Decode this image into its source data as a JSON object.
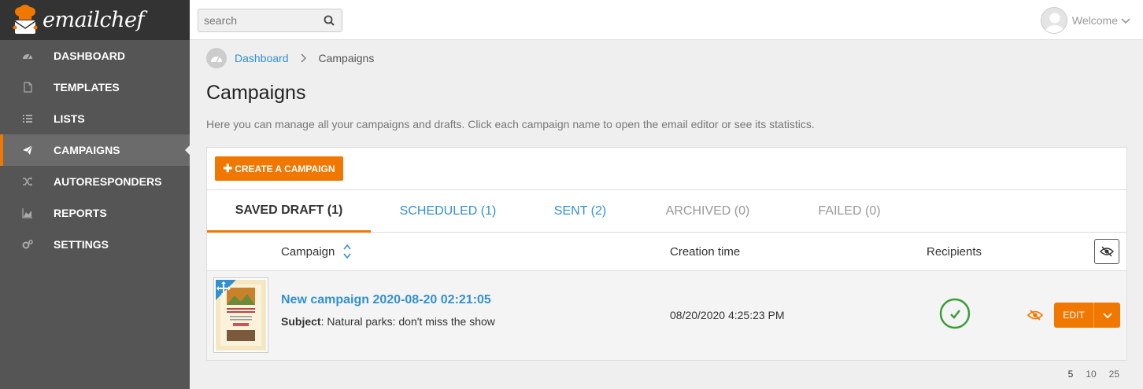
{
  "app": {
    "name": "emailchef"
  },
  "sidebar": {
    "items": [
      {
        "label": "DASHBOARD",
        "icon": "dashboard-icon"
      },
      {
        "label": "TEMPLATES",
        "icon": "file-icon"
      },
      {
        "label": "LISTS",
        "icon": "list-icon"
      },
      {
        "label": "CAMPAIGNS",
        "icon": "paper-plane-icon",
        "active": true
      },
      {
        "label": "AUTORESPONDERS",
        "icon": "shuffle-icon"
      },
      {
        "label": "REPORTS",
        "icon": "area-chart-icon"
      },
      {
        "label": "SETTINGS",
        "icon": "gears-icon"
      }
    ]
  },
  "header": {
    "search_placeholder": "search",
    "welcome": "Welcome"
  },
  "breadcrumb": {
    "home": "Dashboard",
    "current": "Campaigns"
  },
  "page": {
    "title": "Campaigns",
    "description": "Here you can manage all your campaigns and drafts. Click each campaign name to open the email editor or see its statistics."
  },
  "panel": {
    "create_label": "CREATE A CAMPAIGN",
    "tabs": [
      {
        "label": "SAVED DRAFT (1)",
        "state": "active"
      },
      {
        "label": "SCHEDULED (1)",
        "state": "link"
      },
      {
        "label": "SENT (2)",
        "state": "link"
      },
      {
        "label": "ARCHIVED (0)",
        "state": "disabled"
      },
      {
        "label": "FAILED (0)",
        "state": "disabled"
      }
    ],
    "columns": {
      "campaign": "Campaign",
      "creation_time": "Creation time",
      "recipients": "Recipients"
    },
    "rows": [
      {
        "name": "New campaign 2020-08-20 02:21:05",
        "subject_label": "Subject",
        "subject": ": Natural parks: don't miss the show",
        "creation_time": "08/20/2020 4:25:23 PM",
        "edit_label": "EDIT"
      }
    ]
  },
  "pagination": {
    "sizes": [
      "5",
      "10",
      "25"
    ],
    "active": "5"
  },
  "colors": {
    "accent": "#f07800",
    "link": "#3290d0",
    "success": "#3a9d3a",
    "sidebar": "#555555"
  }
}
